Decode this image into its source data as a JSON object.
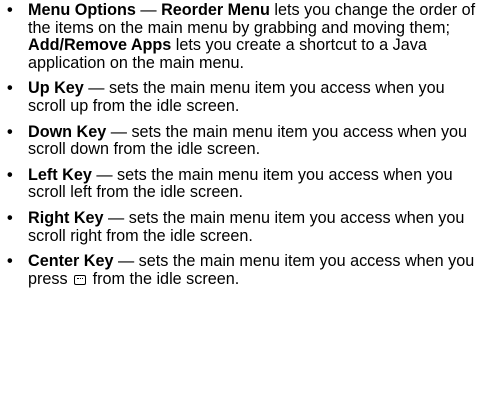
{
  "bullet_symbol": "•",
  "items": [
    {
      "term": "Menu Options",
      "dash": " — ",
      "sub1_term": "Reorder Menu",
      "sub1_text": " lets you change the order of the items on the main menu by grabbing and moving them; ",
      "sub2_term": "Add/Remove Apps",
      "sub2_text": " lets you create a shortcut to a Java application on the main menu."
    },
    {
      "term": "Up Key",
      "text": " — sets the main menu item you access when you scroll up from the idle screen."
    },
    {
      "term": "Down Key",
      "text": " — sets the main menu item you access when you scroll down from the idle screen."
    },
    {
      "term": "Left Key",
      "text": " — sets the main menu item you access when you scroll left from the idle screen."
    },
    {
      "term": "Right Key",
      "text": " — sets the main menu item you access when you scroll right from the idle screen."
    },
    {
      "term": "Center Key",
      "text_before_icon": " — sets the main menu item you access when you press ",
      "icon": "menu-ok-key-icon",
      "text_after_icon": " from the idle screen."
    }
  ]
}
